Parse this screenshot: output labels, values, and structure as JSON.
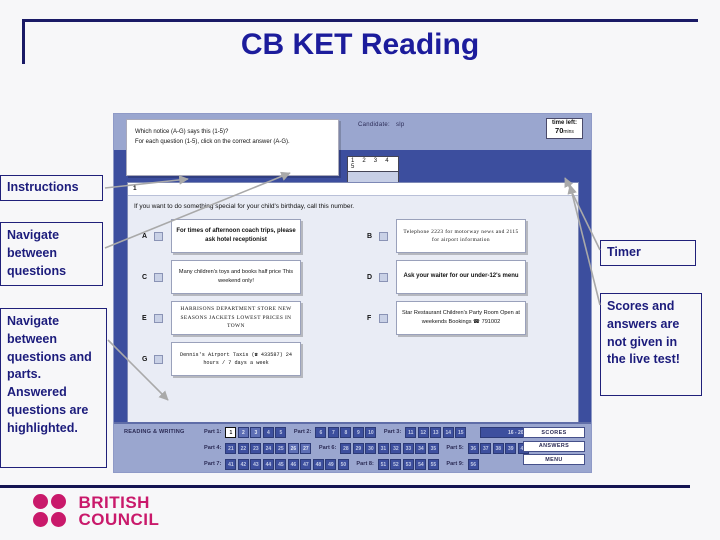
{
  "page_title": "CB KET Reading",
  "colors": {
    "title": "#1c1c9c",
    "rule": "#1a1a66",
    "callout_border": "#20207a",
    "screenshot_bg": "#3c4e9e",
    "screenshot_bar": "#9aa6cf",
    "logo": "#c9196b"
  },
  "callouts": {
    "instructions": "Instructions",
    "navigate_questions": "Navigate between questions",
    "navigate_questions_parts": "Navigate between questions and parts. Answered questions are highlighted.",
    "timer": "Timer",
    "scores_note": "Scores and answers are not given in the live test!"
  },
  "logo": {
    "line1": "BRITISH",
    "line2": "COUNCIL"
  },
  "screenshot": {
    "candidate_label": "Candidate:",
    "candidate_value": "slp",
    "time_left_label": "time left:",
    "time_left_value": "70",
    "time_left_unit": "mins",
    "instructions_line1": "Which notice (A-G) says this (1-5)?",
    "instructions_line2": "For each question (1-5), click on the correct answer (A-G).",
    "question_numbers": "1 2 3 4 5",
    "question_index": "1",
    "question_stem": "If you want to do something special for your child's birthday, call this number.",
    "options": [
      {
        "letter": "A",
        "text": "For times of afternoon coach trips, please ask hotel receptionist",
        "style": "bold"
      },
      {
        "letter": "B",
        "text": "Telephone 2223 for motorway news and 2115 for airport information",
        "style": "serif"
      },
      {
        "letter": "C",
        "text": "Many children's toys and books half price This weekend only!",
        "style": "plain"
      },
      {
        "letter": "D",
        "text": "Ask your waiter for our under-12's menu",
        "style": "bold"
      },
      {
        "letter": "E",
        "text": "HARRISONS DEPARTMENT STORE NEW SEASONS JACKETS LOWEST PRICES IN TOWN",
        "style": "serif"
      },
      {
        "letter": "F",
        "text": "Star Restaurant Children's Party Room Open at weekends Bookings ☎ 791002",
        "style": "plain"
      },
      {
        "letter": "G",
        "text": "Dennis's Airport Taxis (☎ 433587) 24 hours / 7 days a week",
        "style": "mono"
      }
    ],
    "nav": {
      "section_title": "READING & WRITING",
      "rows": [
        {
          "groups": [
            {
              "label": "Part 1:",
              "buttons": [
                "1",
                "2",
                "3",
                "4",
                "5"
              ],
              "active": "1",
              "answered": [
                "2",
                "3"
              ]
            },
            {
              "label": "Part 2:",
              "buttons": [
                "6",
                "7",
                "8",
                "9",
                "10"
              ],
              "active": "",
              "answered": []
            },
            {
              "label": "Part 3:",
              "buttons": [
                "11",
                "12",
                "13",
                "14",
                "15"
              ],
              "active": "",
              "answered": []
            }
          ],
          "wide_button": "16 - 20"
        },
        {
          "groups": [
            {
              "label": "Part 4:",
              "buttons": [
                "21",
                "22",
                "23",
                "24",
                "25",
                "26",
                "27"
              ],
              "active": "",
              "answered": [
                "26",
                "27"
              ]
            },
            {
              "label": "Part 6:",
              "buttons": [
                "28",
                "29",
                "30",
                "31",
                "32",
                "33",
                "34",
                "35"
              ],
              "active": "",
              "answered": []
            },
            {
              "label": "Part 5:",
              "buttons": [
                "36",
                "37",
                "38",
                "39",
                "40"
              ],
              "active": "",
              "answered": []
            }
          ],
          "wide_button": ""
        },
        {
          "groups": [
            {
              "label": "Part 7:",
              "buttons": [
                "41",
                "42",
                "43",
                "44",
                "45",
                "46",
                "47",
                "48",
                "49",
                "50"
              ],
              "active": "",
              "answered": []
            },
            {
              "label": "Part 8:",
              "buttons": [
                "51",
                "52",
                "53",
                "54",
                "55"
              ],
              "active": "",
              "answered": []
            },
            {
              "label": "Part 9:",
              "buttons": [
                "56"
              ],
              "active": "",
              "answered": []
            }
          ],
          "wide_button": ""
        }
      ],
      "side_buttons": [
        "SCORES",
        "ANSWERS",
        "MENU"
      ]
    }
  }
}
